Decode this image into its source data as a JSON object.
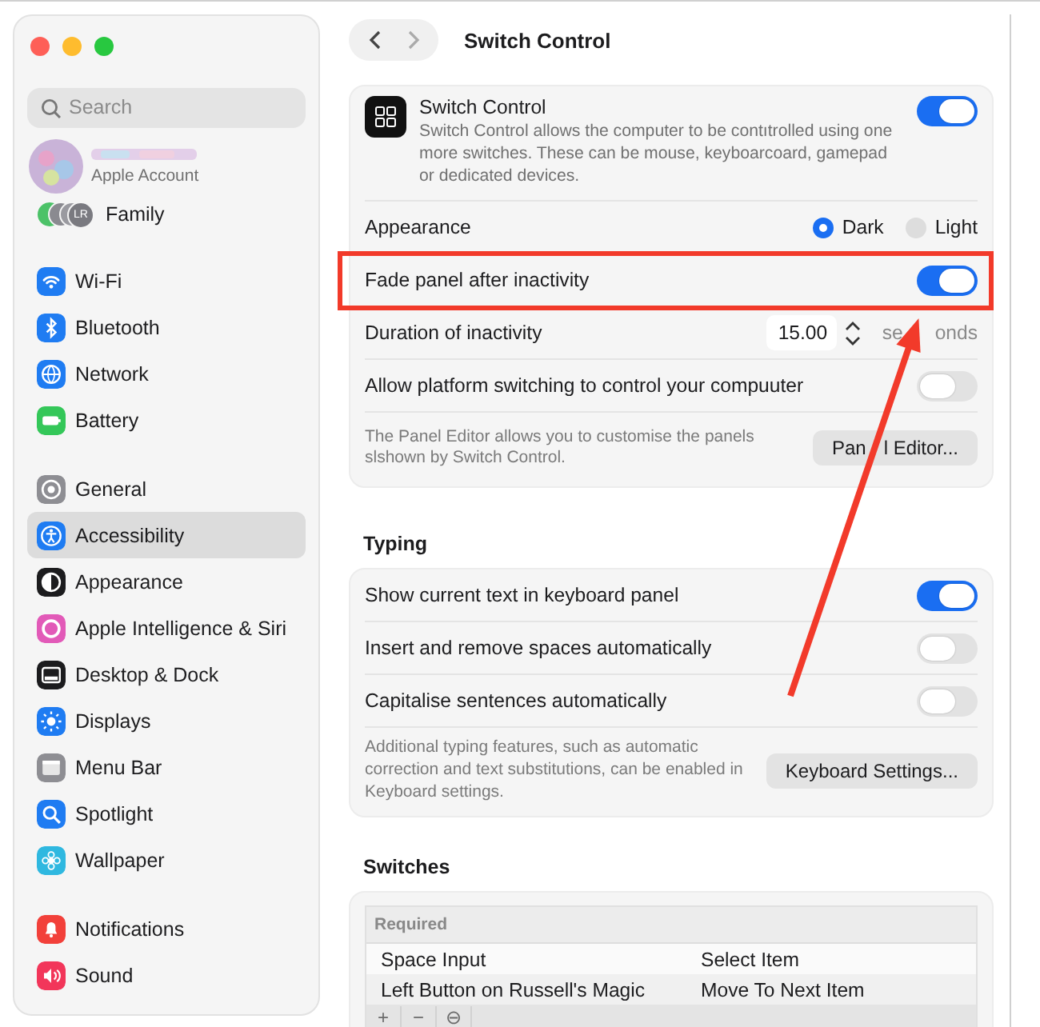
{
  "window": {
    "title": "Switch Control"
  },
  "sidebar": {
    "search": {
      "placeholder": "Search"
    },
    "account": {
      "label": "Apple Account"
    },
    "family": {
      "label": "Family",
      "initials": "LR"
    },
    "groups": [
      {
        "items": [
          {
            "label": "Wi-Fi",
            "color": "#1f7cf2",
            "selected": false
          },
          {
            "label": "Bluetooth",
            "color": "#1f7cf2",
            "selected": false
          },
          {
            "label": "Network",
            "color": "#1f7cf2",
            "selected": false
          },
          {
            "label": "Battery",
            "color": "#34c759",
            "selected": false
          }
        ]
      },
      {
        "items": [
          {
            "label": "General",
            "color": "#8e8e93",
            "selected": false
          },
          {
            "label": "Accessibility",
            "color": "#1f7cf2",
            "selected": true
          },
          {
            "label": "Appearance",
            "color": "#1c1c1e",
            "selected": false
          },
          {
            "label": "Apple Intelligence & Siri",
            "color": "#e25ab8",
            "selected": false
          },
          {
            "label": "Desktop & Dock",
            "color": "#1c1c1e",
            "selected": false
          },
          {
            "label": "Displays",
            "color": "#1f7cf2",
            "selected": false
          },
          {
            "label": "Menu Bar",
            "color": "#8e8e93",
            "selected": false
          },
          {
            "label": "Spotlight",
            "color": "#1f7cf2",
            "selected": false
          },
          {
            "label": "Wallpaper",
            "color": "#2fb8e0",
            "selected": false
          }
        ]
      },
      {
        "items": [
          {
            "label": "Notifications",
            "color": "#f2403a",
            "selected": false
          },
          {
            "label": "Sound",
            "color": "#f2365a",
            "selected": false
          }
        ]
      }
    ]
  },
  "switch_control": {
    "title": "Switch Control",
    "description": "Switch Control allows the computer to be contıtrolled using one more switches. These can be mouse, keyboarcoard, gamepad or dedicated devices.",
    "on": true
  },
  "settings": [
    {
      "kind": "radio",
      "label": "Appearance",
      "highlighted": false,
      "options": [
        {
          "label": "Dark",
          "selected": true
        },
        {
          "label": "Light",
          "selected": false
        }
      ]
    },
    {
      "kind": "toggle",
      "label": "Fade panel after inactivity",
      "highlighted": true,
      "on": true
    },
    {
      "kind": "stepper",
      "label": "Duration of inactivity",
      "highlighted": false,
      "value": "15.00",
      "unit": [
        "se",
        "onds"
      ]
    },
    {
      "kind": "toggle",
      "label": "Allow platform switching to control your compuuter",
      "highlighted": false,
      "on": false
    }
  ],
  "panel_footer": {
    "text": "The Panel Editor allows you to customise the panels slshown by Switch Control.",
    "button": [
      "Pan",
      "l Editor..."
    ]
  },
  "typing": {
    "heading": "Typing",
    "settings": [
      {
        "kind": "toggle",
        "label": "Show current text in keyboard panel",
        "on": true
      },
      {
        "kind": "toggle",
        "label": "Insert and remove spaces automatically",
        "on": false
      },
      {
        "kind": "toggle",
        "label": "Capitalise sentences automatically",
        "on": false
      }
    ],
    "footer": {
      "text": "Additional typing features, such as automatic correction and text substitutions, can be enabled in Keyboard settings.",
      "button": "Keyboard Settings..."
    }
  },
  "switches": {
    "heading": "Switches",
    "group": "Required",
    "rows": [
      {
        "cells": [
          "Space Input",
          "Select Item"
        ]
      },
      {
        "cells": [
          "Left Button on Russell's Magic",
          "Move To Next Item"
        ]
      }
    ],
    "toolbar": [
      "+",
      "−",
      "⊖"
    ]
  }
}
